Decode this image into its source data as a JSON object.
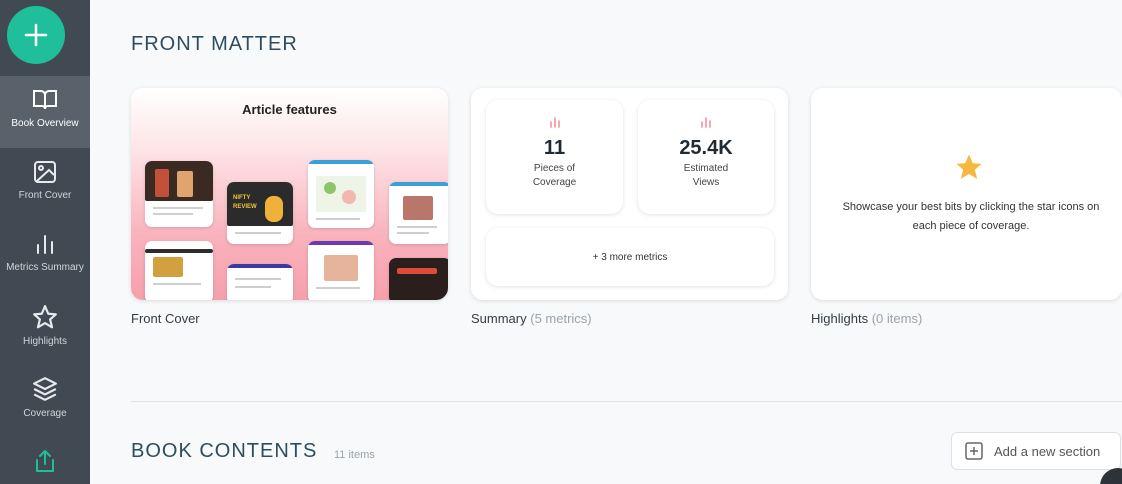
{
  "sidebar": {
    "items": [
      {
        "label": "Book Overview",
        "icon": "book-open-icon"
      },
      {
        "label": "Front Cover",
        "icon": "image-icon"
      },
      {
        "label": "Metrics Summary",
        "icon": "bar-chart-icon"
      },
      {
        "label": "Highlights",
        "icon": "star-icon"
      },
      {
        "label": "Coverage",
        "icon": "layers-icon"
      },
      {
        "label": "",
        "icon": "share-upload-icon"
      }
    ]
  },
  "front_matter": {
    "title": "FRONT MATTER",
    "front_cover": {
      "heading": "Article features",
      "label": "Front Cover"
    },
    "summary": {
      "metrics": [
        {
          "value": "11",
          "label_line1": "Pieces of",
          "label_line2": "Coverage"
        },
        {
          "value": "25.4K",
          "label_line1": "Estimated",
          "label_line2": "Views"
        }
      ],
      "more_label": "+ 3 more metrics",
      "label": "Summary",
      "label_note": "(5 metrics)"
    },
    "highlights": {
      "text": "Showcase your best bits by clicking the star icons on each piece of coverage.",
      "label": "Highlights",
      "label_note": "(0 items)"
    }
  },
  "book_contents": {
    "title": "BOOK CONTENTS",
    "count": "11 items",
    "add_section_label": "Add a new section"
  },
  "thumbnail_text": "NIFTY REVIEW",
  "colors": {
    "sidebar": "#414a52",
    "accent": "#1fbf9b",
    "title": "#2f4d5e",
    "star": "#f5b942",
    "metric_icon": "#f08b94"
  }
}
